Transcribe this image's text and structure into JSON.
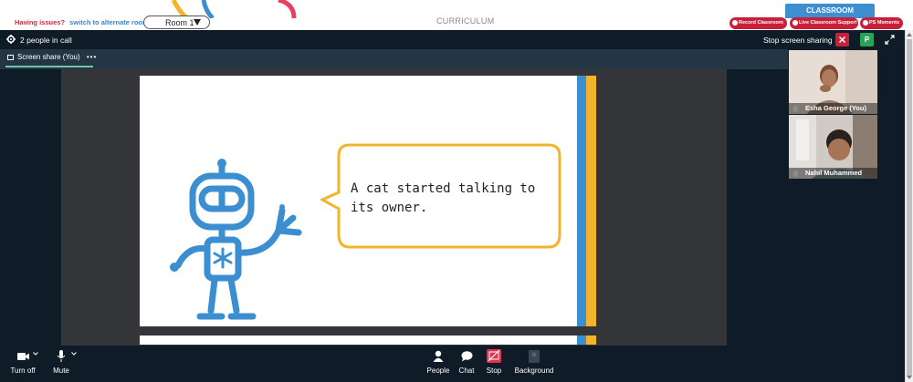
{
  "topbar": {
    "issues_text": "Having issues?",
    "alternate_room_link": "switch to alternate room",
    "room_select_value": "Room 1",
    "curriculum_label": "CURRICULUM",
    "classroom_tab": "CLASSROOM",
    "pills": [
      "Record Classroom",
      "Live Classroom Support",
      "PS Moments"
    ]
  },
  "call": {
    "people_count": "2 people in call",
    "stop_sharing_label": "Stop screen sharing",
    "avatar_initial": "P",
    "share_tab_label": "Screen share (You)",
    "share_tab_more": "•••"
  },
  "slide": {
    "bubble_text": "A cat started talking to its owner."
  },
  "participants": [
    {
      "name": "Esha George (You)"
    },
    {
      "name": "Nahil Muhammed"
    }
  ],
  "toolbar": {
    "turn_off": "Turn off",
    "mute": "Mute",
    "people": "People",
    "chat": "Chat",
    "stop": "Stop",
    "background": "Background"
  },
  "colors": {
    "brand_red": "#c8203b",
    "brand_blue": "#3d8fd1",
    "slide_yellow": "#f1b42a",
    "robot_blue": "#3b8fd0",
    "call_bg": "#0f1b26"
  }
}
